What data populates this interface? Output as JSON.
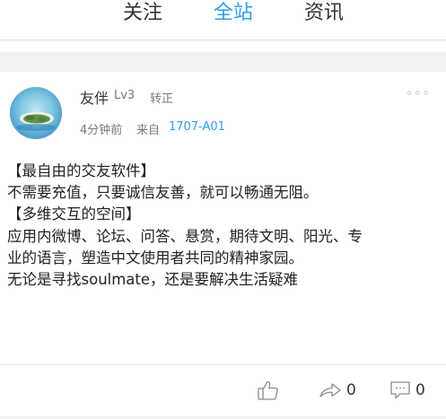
{
  "tabs": [
    {
      "label": "关注"
    },
    {
      "label": "全站",
      "active": true
    },
    {
      "label": "资讯"
    }
  ],
  "post": {
    "username": "友伴",
    "level": "Lv3",
    "status": "转正",
    "more": "◦◦◦",
    "time": "4分钟前",
    "from_label": "来自",
    "source": "1707-A01",
    "lines": [
      "【最自由的交友软件】",
      "不需要充值，只要诚信友善，就可以畅通无阻。",
      "【多维交互的空间】",
      "应用内微博、论坛、问答、悬赏，期待文明、阳光、专",
      "业的语言，塑造中文使用者共同的精神家园。",
      "无论是寻找soulmate，还是要解决生活疑难"
    ],
    "actions": {
      "like_icon": "thumbs-up-icon",
      "share_icon": "share-icon",
      "share_count": "0",
      "comment_icon": "comment-icon",
      "comment_count": "0"
    }
  },
  "colors": {
    "accent": "#2f9ee8",
    "background_gap": "#f2f2f2"
  }
}
